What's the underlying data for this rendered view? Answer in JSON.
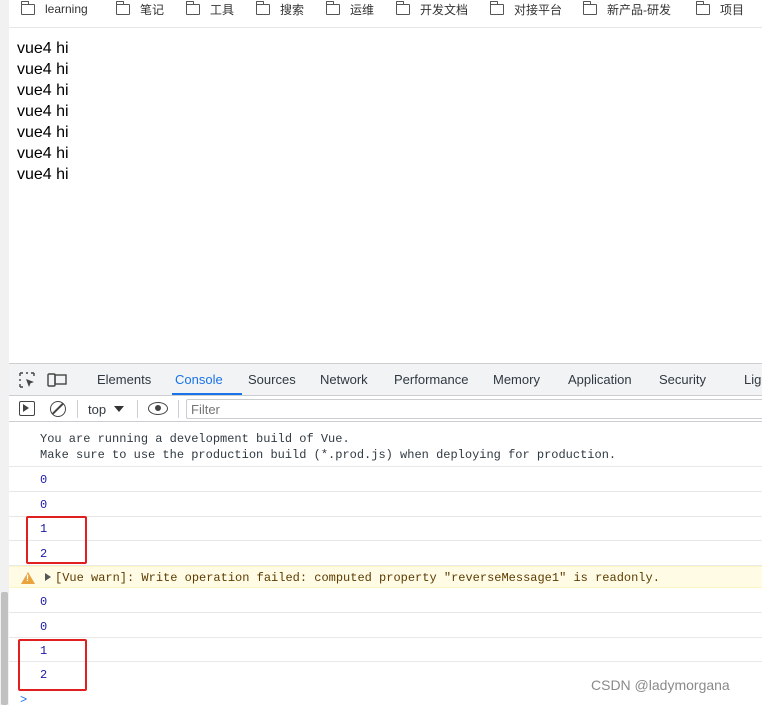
{
  "bookmarks": [
    {
      "label": "learning",
      "icon": "folder-icon"
    },
    {
      "label": "笔记",
      "icon": "folder-icon"
    },
    {
      "label": "工具",
      "icon": "folder-icon"
    },
    {
      "label": "搜索",
      "icon": "folder-icon"
    },
    {
      "label": "运维",
      "icon": "folder-icon"
    },
    {
      "label": "开发文档",
      "icon": "folder-icon"
    },
    {
      "label": "对接平台",
      "icon": "folder-icon"
    },
    {
      "label": "新产品-研发",
      "icon": "folder-icon"
    },
    {
      "label": "项目",
      "icon": "folder-icon"
    }
  ],
  "page": {
    "lines": [
      "vue4 hi",
      "vue4 hi",
      "vue4 hi",
      "vue4 hi",
      "vue4 hi",
      "vue4 hi",
      "vue4 hi"
    ]
  },
  "devtools": {
    "icons": {
      "inspect": "inspect-element-icon",
      "device": "device-toolbar-icon"
    },
    "tabs": [
      {
        "label": "Elements"
      },
      {
        "label": "Console",
        "active": true
      },
      {
        "label": "Sources"
      },
      {
        "label": "Network"
      },
      {
        "label": "Performance"
      },
      {
        "label": "Memory"
      },
      {
        "label": "Application"
      },
      {
        "label": "Security"
      },
      {
        "label": "Lig"
      }
    ],
    "toolbar": {
      "context": "top",
      "filter_placeholder": "Filter"
    },
    "console": {
      "info": "You are running a development build of Vue.\nMake sure to use the production build (*.prod.js) when deploying for production.",
      "logs_a": [
        "0",
        "0",
        "1",
        "2"
      ],
      "warning": "[Vue warn]: Write operation failed: computed property \"reverseMessage1\" is readonly.",
      "logs_b": [
        "0",
        "0",
        "1",
        "2"
      ],
      "prompt": ">"
    },
    "colors": {
      "accent": "#1a73e8",
      "number": "#1a1aa6",
      "highlight": "#e02020",
      "warning_bg": "#fffbe5"
    }
  },
  "watermark": "CSDN @ladymorgana"
}
